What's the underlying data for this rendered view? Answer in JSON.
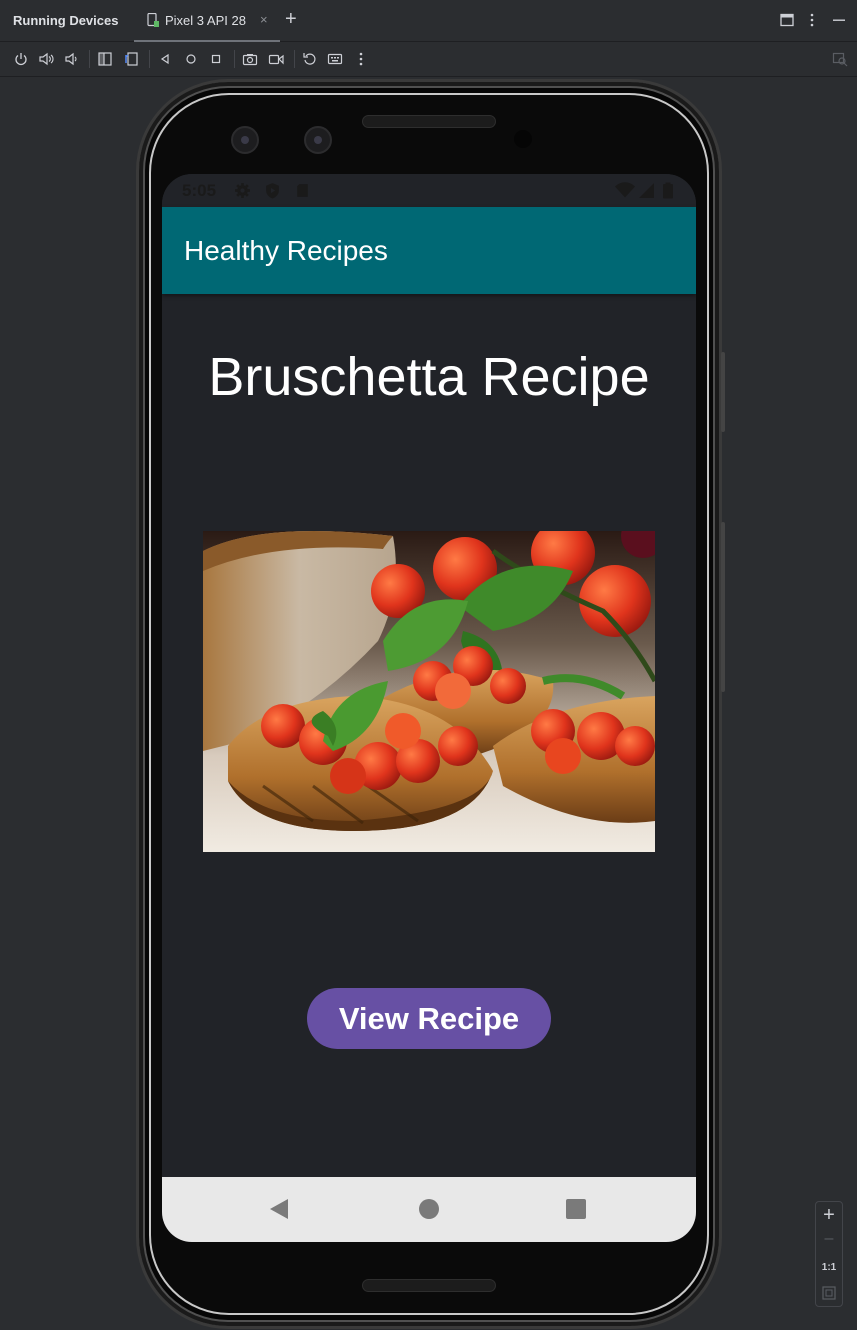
{
  "tool_window": {
    "title": "Running Devices",
    "device_tab_label": "Pixel 3 API 28",
    "close_glyph": "×",
    "add_tab_glyph": "+"
  },
  "toolbar": {
    "icons": [
      "power-icon",
      "volume-up-icon",
      "volume-down-icon",
      "rotate-left-icon",
      "rotate-right-icon",
      "back-icon",
      "home-icon",
      "overview-icon",
      "screenshot-icon",
      "screen-record-icon",
      "reset-icon",
      "keyboard-icon",
      "more-icon"
    ]
  },
  "phone": {
    "status_bar": {
      "time": "5:05"
    },
    "app_bar": {
      "title": "Healthy Recipes"
    },
    "content": {
      "recipe_title": "Bruschetta Recipe",
      "image_alt": "bruschetta-photo",
      "button_label": "View Recipe"
    }
  },
  "zoom_panel": {
    "zoom_in": "+",
    "zoom_out": "–",
    "actual_size": "1:1"
  },
  "colors": {
    "app_bar": "#006874",
    "button": "#6750a4",
    "screen_bg": "#212328",
    "ide_bg": "#2b2d30"
  }
}
